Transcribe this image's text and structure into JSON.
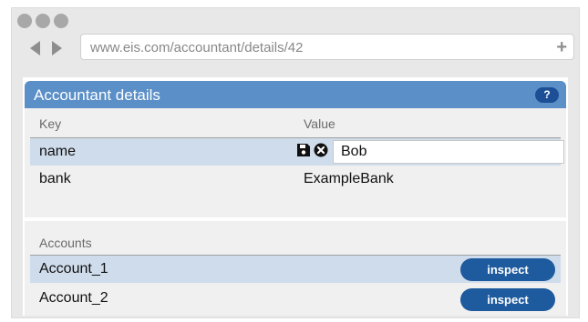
{
  "browser": {
    "url": "www.eis.com/accountant/details/42"
  },
  "panel": {
    "title": "Accountant details",
    "help_label": "?"
  },
  "details": {
    "key_header": "Key",
    "value_header": "Value",
    "rows": [
      {
        "key": "name",
        "value": "Bob"
      },
      {
        "key": "bank",
        "value": "ExampleBank"
      }
    ]
  },
  "accounts": {
    "header": "Accounts",
    "items": [
      {
        "label": "Account_1",
        "action": "inspect"
      },
      {
        "label": "Account_2",
        "action": "inspect"
      }
    ]
  },
  "colors": {
    "header_bg": "#5b8fc7",
    "selected_row": "#cfdceb",
    "button_bg": "#1e5a9e"
  }
}
